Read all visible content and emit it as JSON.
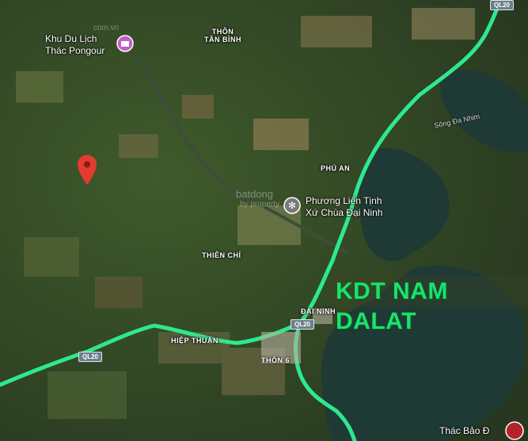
{
  "places": {
    "pongour": [
      "Khu Du Lịch",
      "Thác Pongour"
    ],
    "tan_binh": [
      "THÔN",
      "TÂN BÌNH"
    ],
    "phu_an": "PHÚ AN",
    "chua_dai_ninh": [
      "Phương Liên Tịnh",
      "Xứ Chùa Đại Ninh"
    ],
    "thien_chi": "THIÊN CHÍ",
    "dai_ninh": "ĐẠI NINH",
    "hiep_thuan": "HIỆP THUẬN",
    "thon_6": "THÔN 6",
    "thac_bao_dai": "Thác Bảo Đ",
    "song_da_nhim": "Sông Đa Nhim"
  },
  "road_shields": {
    "ql20_a": "QL20",
    "ql20_b": "QL20",
    "ql20_c": "QL20"
  },
  "banner": "KDT NAM DALAT",
  "watermarks": {
    "top": "com.vn",
    "center": "batdong",
    "center2": "by property"
  },
  "colors": {
    "road": "#2ee88f",
    "pin": "#e33b2e",
    "poi": "#c15ec9",
    "banner_text": "#19e36b",
    "water": "#1f3a34"
  }
}
